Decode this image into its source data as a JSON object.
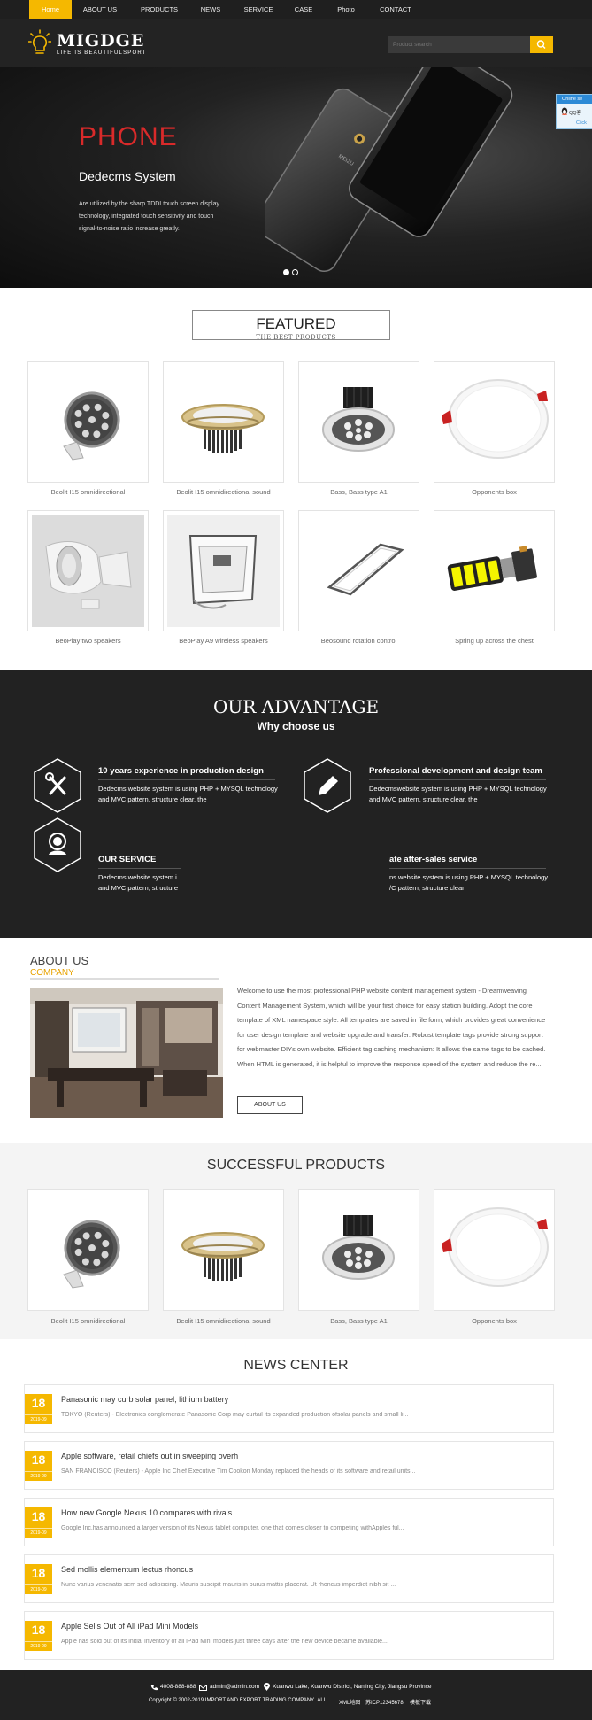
{
  "nav": {
    "items": [
      {
        "label": "Home",
        "active": true
      },
      {
        "label": "ABOUT US"
      },
      {
        "label": "PRODUCTS"
      },
      {
        "label": "NEWS"
      },
      {
        "label": "SERVICE"
      },
      {
        "label": "CASE"
      },
      {
        "label": "Photo"
      },
      {
        "label": "CONTACT"
      }
    ]
  },
  "header": {
    "logo_title": "MIGDGE",
    "logo_sub": "LIFE IS BEAUTIFULSPORT",
    "search_placeholder": "Product search"
  },
  "banner": {
    "title": "PHONE",
    "subtitle": "Dedecms System",
    "desc": "Are utilized by the sharp TDDI touch screen display technology, integrated touch sensitivity and touch signal-to-noise ratio increase greatly."
  },
  "online": {
    "label": "Online se",
    "qq": "QQ客",
    "click": "Click"
  },
  "featured": {
    "title": "FEATURED",
    "subtitle": "THE BEST PRODUCTS",
    "products": [
      {
        "caption": "Beolit I15 omnidirectional",
        "icon": "floodlight-icon"
      },
      {
        "caption": "Beolit I15 omnidirectional sound",
        "icon": "downlight-gold-icon"
      },
      {
        "caption": "Bass, Bass type A1",
        "icon": "led-spotlight-icon"
      },
      {
        "caption": "Opponents box",
        "icon": "round-panel-icon"
      },
      {
        "caption": "BeoPlay two speakers",
        "icon": "white-lamp-icon"
      },
      {
        "caption": "BeoPlay A9 wireless speakers",
        "icon": "flood-panel-icon"
      },
      {
        "caption": "Beosound rotation control",
        "icon": "flat-panel-icon"
      },
      {
        "caption": "Spring up across the chest",
        "icon": "car-bulb-icon"
      }
    ]
  },
  "advantage": {
    "title": "OUR ADVANTAGE",
    "subtitle": "Why choose us",
    "items": [
      {
        "title": "10 years experience in production design",
        "line1": "Dedecms website system is using PHP + MYSQL technology",
        "line2": "and MVC pattern, structure clear, the",
        "icon": "tools-icon"
      },
      {
        "title": "Professional development and design team",
        "line1": "Dedecmswebsite system is using PHP + MYSQL technology",
        "line2": "and MVC pattern, structure clear, the",
        "icon": "pencil-icon"
      },
      {
        "title": "OUR SERVICE",
        "line1": "Dedecms website system i",
        "line2": "and MVC pattern, structure",
        "icon": "support-icon"
      },
      {
        "title": "ate after-sales service",
        "line1": "ns website system is using PHP + MYSQL technology",
        "line2": "/C pattern, structure clear",
        "icon": ""
      }
    ]
  },
  "about": {
    "title": "ABOUT US",
    "subtitle": "COMPANY",
    "text": "Welcome to use the most professional PHP website content management system - Dreamweaving Content Management System, which will be your first choice for easy station building. Adopt the core template of XML namespace style: All templates are saved in file form, which provides great convenience for user design template and website upgrade and transfer. Robust template tags provide strong support for webmaster DIYs own website. Efficient tag caching mechanism: It allows the same tags to be cached. When HTML is generated, it is helpful to improve the response speed of the system and reduce the re...",
    "button": "ABOUT US"
  },
  "successful": {
    "title": "SUCCESSFUL PRODUCTS",
    "products": [
      {
        "caption": "Beolit I15 omnidirectional"
      },
      {
        "caption": "Beolit I15 omnidirectional sound"
      },
      {
        "caption": "Bass, Bass type A1"
      },
      {
        "caption": "Opponents box"
      }
    ]
  },
  "news": {
    "title": "NEWS CENTER",
    "items": [
      {
        "day": "18",
        "ym": "2019-09",
        "title": "Panasonic may curb solar panel, lithium battery",
        "summary": "TOKYO (Reuters) - Electronics conglomerate Panasonic Corp may curtail its expanded production ofsolar panels and small li..."
      },
      {
        "day": "18",
        "ym": "2019-09",
        "title": "Apple software, retail chiefs out in sweeping overh",
        "summary": "SAN FRANCISCO (Reuters) - Apple Inc Chief Executive Tim Cookon Monday replaced the heads of its software and retail units..."
      },
      {
        "day": "18",
        "ym": "2019-09",
        "title": "How new Google Nexus 10 compares with rivals",
        "summary": "Google Inc.has announced a larger version of its Nexus tablet computer, one that comes closer to competing withApples ful..."
      },
      {
        "day": "18",
        "ym": "2019-09",
        "title": "Sed mollis elementum lectus rhoncus",
        "summary": "Nunc varius venenatis sem sed adipiscing. Mauris suscipit mauris in purus mattis placerat. Ut rhoncus imperdiet nibh sit ..."
      },
      {
        "day": "18",
        "ym": "2019-09",
        "title": "Apple Sells Out of All iPad Mini Models",
        "summary": "Apple has sold out of its initial inventory of all iPad Mini models just three days after the new device became available..."
      }
    ]
  },
  "footer": {
    "phone": "4008-888-888",
    "email": "admin@admin.com",
    "address": "Xuanwu Lake, Xuanwu District, Nanjing City, Jiangsu Province",
    "copyright": "Copyright © 2002-2019 IMPORT AND EXPORT TRADING COMPANY .ALL",
    "xml": "XML地图",
    "icp": "苏ICP12345678",
    "template": "模板下载"
  },
  "colors": {
    "accent": "#f5b800",
    "dark": "#222222",
    "red": "#d92a2a",
    "about_subtitle": "#e8a300"
  }
}
